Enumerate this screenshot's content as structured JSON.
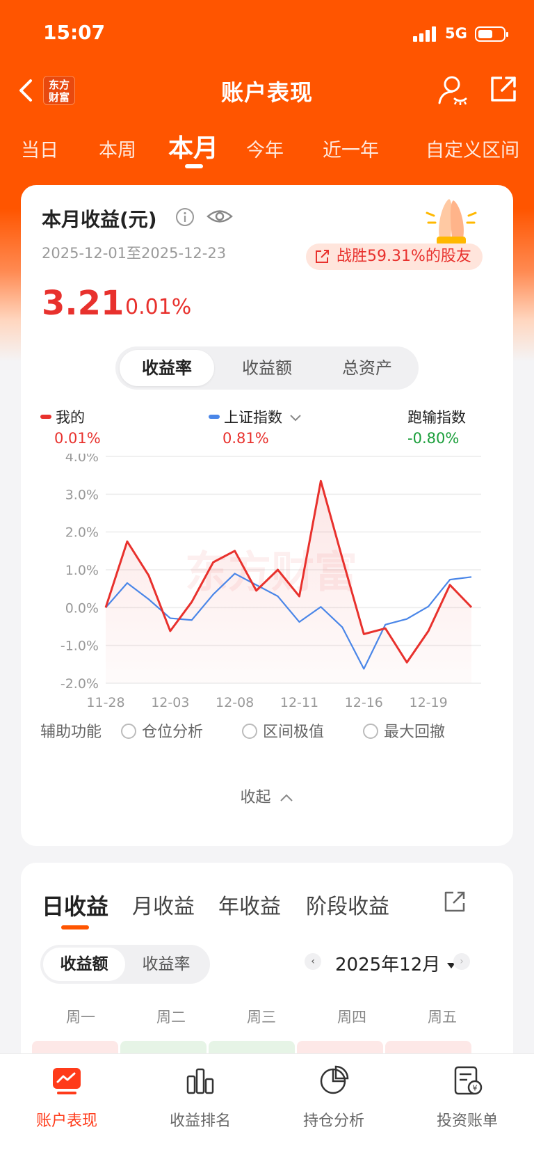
{
  "status_bar": {
    "time": "15:07",
    "network": "5G"
  },
  "header": {
    "title": "账户表现",
    "logo_line1": "东方",
    "logo_line2": "财富"
  },
  "period_tabs": [
    "当日",
    "本周",
    "本月",
    "今年",
    "近一年",
    "自定义区间"
  ],
  "period_active": "本月",
  "summary": {
    "title": "本月收益(元)",
    "date_range": "2025-12-01至2025-12-23",
    "beat_text": "战胜59.31%的股友",
    "value": "3.21",
    "percent": "0.01%"
  },
  "chart_tabs": [
    "收益率",
    "收益额",
    "总资产"
  ],
  "chart_tab_active": "收益率",
  "legend": {
    "mine_label": "我的",
    "mine_value": "0.01%",
    "index_label": "上证指数",
    "index_value": "0.81%",
    "lose_label": "跑输指数",
    "lose_value": "-0.80%"
  },
  "colors": {
    "accent": "#ff5500",
    "up": "#e8312d",
    "down": "#1a9e3a",
    "index_line": "#4a86e8"
  },
  "watermark_text": "东方财富",
  "chart_data": {
    "type": "line",
    "x": [
      "11-28",
      "12-01",
      "12-02",
      "12-03",
      "12-04",
      "12-05",
      "12-08",
      "12-09",
      "12-10",
      "12-11",
      "12-12",
      "12-15",
      "12-16",
      "12-17",
      "12-18",
      "12-19",
      "12-22",
      "12-23"
    ],
    "x_tick_labels": [
      "11-28",
      "12-03",
      "12-08",
      "12-11",
      "12-16",
      "12-19"
    ],
    "y_tick_labels": [
      "4.0%",
      "3.0%",
      "2.0%",
      "1.0%",
      "0.0%",
      "-1.0%",
      "-2.0%"
    ],
    "ylim": [
      -2.0,
      4.0
    ],
    "series": [
      {
        "name": "我的",
        "values": [
          0.0,
          1.75,
          0.85,
          -0.62,
          0.15,
          1.2,
          1.5,
          0.45,
          1.0,
          0.3,
          3.35,
          1.3,
          -0.7,
          -0.55,
          -1.45,
          -0.62,
          0.6,
          0.01
        ]
      },
      {
        "name": "上证指数",
        "values": [
          0.0,
          0.65,
          0.22,
          -0.28,
          -0.33,
          0.35,
          0.9,
          0.6,
          0.3,
          -0.38,
          0.02,
          -0.52,
          -1.62,
          -0.45,
          -0.3,
          0.03,
          0.74,
          0.81
        ]
      }
    ]
  },
  "aux": {
    "label": "辅助功能",
    "options": [
      "仓位分析",
      "区间极值",
      "最大回撤"
    ]
  },
  "collapse_label": "收起",
  "returns": {
    "tabs": [
      "日收益",
      "月收益",
      "年收益",
      "阶段收益"
    ],
    "active_tab": "日收益",
    "seg": [
      "收益额",
      "收益率"
    ],
    "seg_active": "收益额",
    "month": "2025年12月",
    "weekdays": [
      "周一",
      "周二",
      "周三",
      "周四",
      "周五"
    ],
    "cell_colors": [
      "#fde8e7",
      "#e6f4e6",
      "#e6f4e6",
      "#fde8e7",
      "#fde8e7"
    ]
  },
  "tabbar": [
    "账户表现",
    "收益排名",
    "持仓分析",
    "投资账单"
  ],
  "tabbar_active": "账户表现"
}
